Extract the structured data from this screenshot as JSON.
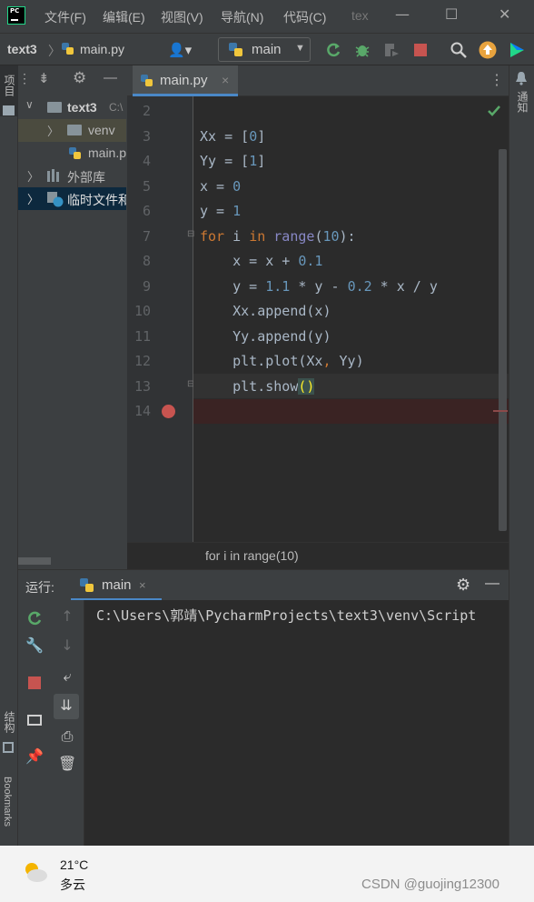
{
  "titlebar": {
    "menu": [
      "文件(F)",
      "编辑(E)",
      "视图(V)",
      "导航(N)",
      "代码(C)",
      "tex"
    ],
    "controls": [
      "—",
      "☐",
      "✕"
    ]
  },
  "navbar": {
    "project": "text3",
    "file": "main.py",
    "run_config": "main"
  },
  "left_stripe": {
    "project_tab": "项目",
    "structure_tab": "结构",
    "bookmarks_tab": "Bookmarks"
  },
  "right_stripe": {
    "notifications_tab": "通知"
  },
  "project_tree": {
    "rows": [
      {
        "label": "text3",
        "suffix": "C:\\"
      },
      {
        "label": "venv"
      },
      {
        "label": "main.py"
      },
      {
        "label": "外部库"
      },
      {
        "label": "临时文件和"
      }
    ]
  },
  "editor": {
    "tab": "main.py",
    "line_numbers": [
      "2",
      "3",
      "4",
      "5",
      "6",
      "7",
      "8",
      "9",
      "10",
      "11",
      "12",
      "13",
      "14"
    ],
    "lines": [
      "",
      "Xx = [0]",
      "Yy = [1]",
      "x = 0",
      "y = 1",
      "for i in range(10):",
      "    x = x + 0.1",
      "    y = 1.1 * y - 0.2 * x / y",
      "    Xx.append(x)",
      "    Yy.append(y)",
      "    plt.plot(Xx, Yy)",
      "    plt.show()",
      ""
    ],
    "breadcrumb": "for i in range(10)"
  },
  "run_panel": {
    "label": "运行:",
    "tab": "main",
    "console_line": "C:\\Users\\郭靖\\PycharmProjects\\text3\\venv\\Script"
  },
  "taskbar": {
    "temperature": "21°C",
    "weather": "多云",
    "watermark": "CSDN @guojing12300"
  },
  "colors": {
    "editor_bg": "#2b2b2b",
    "panel_bg": "#3c3f41",
    "keyword": "#cc7832",
    "number": "#6897bb",
    "breakpoint": "#c75450",
    "python_blue": "#3c77a9",
    "python_yellow": "#f0c63c"
  }
}
